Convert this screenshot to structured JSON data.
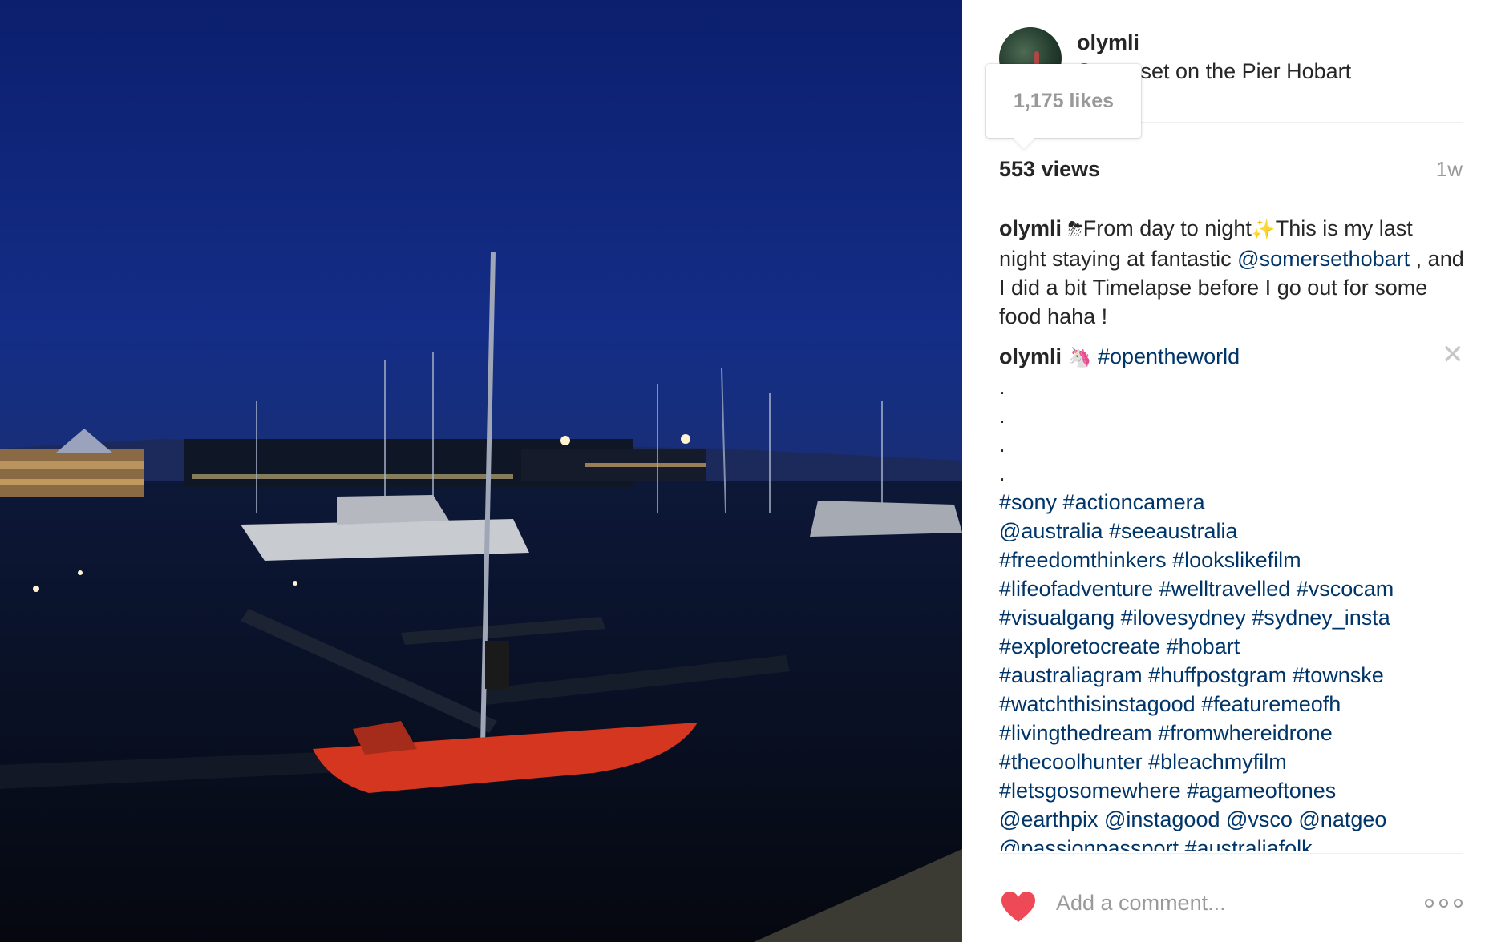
{
  "post": {
    "username": "olymli",
    "location": "Somerset on the Pier Hobart",
    "likes_tooltip": "1,175 likes",
    "views": "553 views",
    "time_ago": "1w"
  },
  "comments": [
    {
      "author": "olymli",
      "emoji": "⛈",
      "parts": {
        "t1": "From day to night",
        "emoji2": "✨",
        "t2": "This is my last night staying at fantastic ",
        "mention": "@somersethobart",
        "t3": " , and I did a bit Timelapse before I go out for some food haha !"
      }
    },
    {
      "author": "olymli",
      "emoji": "🦄",
      "hashtag": "#opentheworld",
      "close_icon": "close-icon",
      "dots": [
        ".",
        ".",
        ".",
        "."
      ],
      "tag_lines": [
        "#sony #actioncamera",
        "@australia #seeaustralia",
        "#freedomthinkers #lookslikefilm",
        "#lifeofadventure #welltravelled #vscocam",
        "#visualgang #ilovesydney #sydney_insta",
        "#exploretocreate #hobart",
        "#australiagram #huffpostgram #townske",
        "#watchthisinstagood #featuremeofh",
        "#livingthedream #fromwhereidrone",
        "#thecoolhunter #bleachmyfilm",
        "#letsgosomewhere #agameoftones",
        "@earthpix @instagood @vsco @natgeo",
        "@passionpassport #australiafolk"
      ]
    }
  ],
  "footer": {
    "like_icon": "heart-icon",
    "comment_placeholder": "Add a comment...",
    "more_icon": "more-options-icon"
  },
  "colors": {
    "link": "#003569",
    "heart": "#ed4956",
    "muted": "#999999",
    "text": "#262626"
  }
}
